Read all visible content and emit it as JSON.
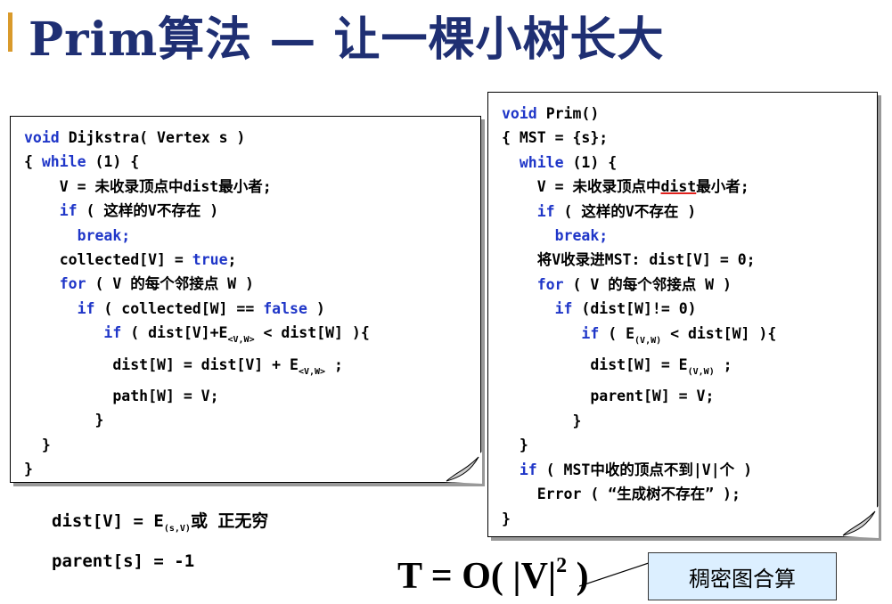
{
  "slide": {
    "title": "Prim算法 — 让一棵小树长大"
  },
  "dijkstra_code": {
    "l1": "Dijkstra( Vertex s )",
    "l2_open": "{ ",
    "l2_rest": " (1) {",
    "l3": "V = 未收录顶点中dist最小者;",
    "l4": " ( 这样的V不存在 )",
    "l6_a": "collected[V] = ",
    "l6_b": ";",
    "l7": " ( V 的每个邻接点 W )",
    "l8_a": " ( collected[W] == ",
    "l8_b": " )",
    "l9_a": " ( dist[V]+E",
    "l9_sub": "<V,W>",
    "l9_b": " < dist[W] ){",
    "l10_a": "dist[W] = dist[V] + E",
    "l10_sub": "<V,W>",
    "l10_b": " ;",
    "l11": "path[W] = V;",
    "l12": "}",
    "l13": "}",
    "l14": "}"
  },
  "prim_code": {
    "l1": "Prim()",
    "l2": "{ MST = {s};",
    "l3": " (1) {",
    "l4_a": "V = 未收录顶点中",
    "l4_u": "dist",
    "l4_b": "最小者;",
    "l5": " ( 这样的V不存在 )",
    "l7": "将V收录进MST: dist[V] = 0;",
    "l8": " ( V 的每个邻接点 W )",
    "l9": " (dist[W]!= 0)",
    "l10_a": " ( E",
    "l10_sub": "(V,W)",
    "l10_b": " < dist[W] ){",
    "l11_a": "dist[W] = E",
    "l11_sub": "(V,W)",
    "l11_b": " ;",
    "l12": "parent[W] = V;",
    "l13": "}",
    "l14": "}",
    "l15": " ( MST中收的顶点不到|V|个 )",
    "l16": "Error ( “生成树不存在” );",
    "l17": "}"
  },
  "keywords": {
    "void": "void",
    "while": "while",
    "if": "if",
    "break": "break;",
    "for": "for",
    "true": "true",
    "false": "false"
  },
  "init_lines": {
    "dist_a": "dist[V] = E",
    "dist_sub": "(s,V)",
    "dist_b": "或 正无穷",
    "parent": "parent[s] = -1"
  },
  "complexity": {
    "prefix": "T = O( |V|",
    "exponent": "2",
    "suffix": " )"
  },
  "badge": {
    "label": "稠密图合算"
  }
}
